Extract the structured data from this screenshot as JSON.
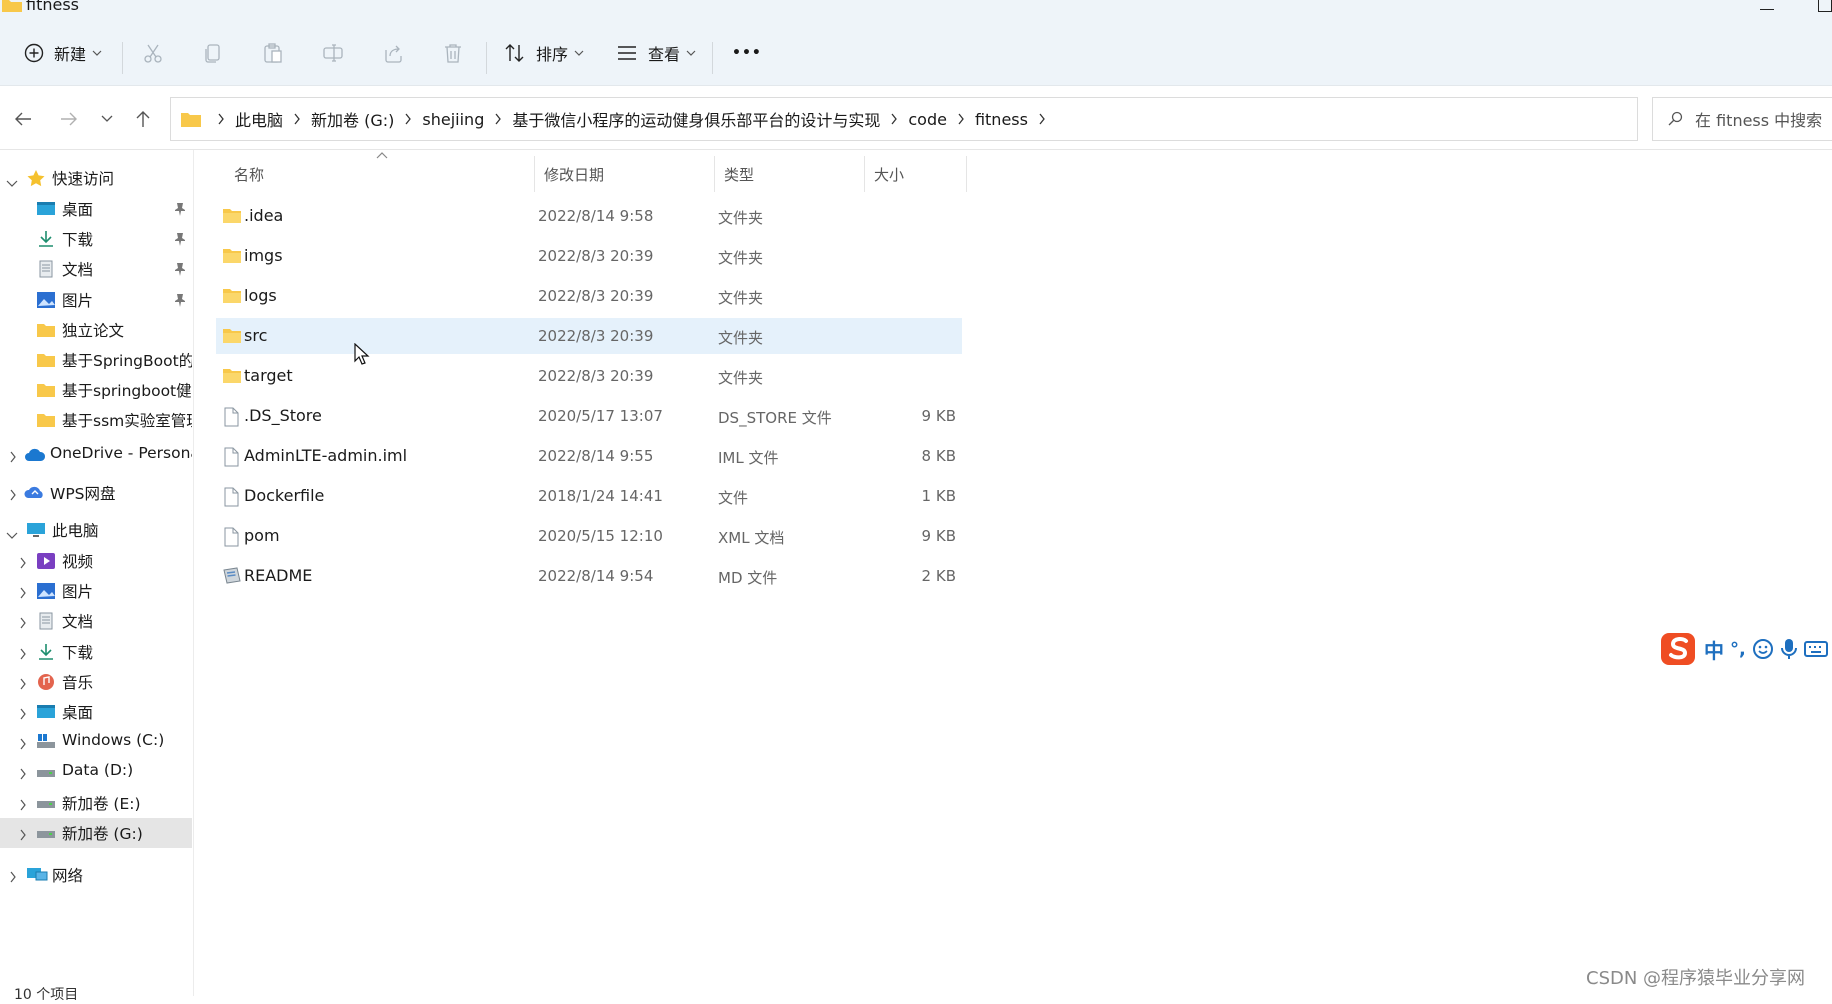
{
  "window": {
    "title": "fitness"
  },
  "toolbar": {
    "new_label": "新建",
    "sort_label": "排序",
    "view_label": "查看",
    "more_label": "•••",
    "icons": [
      "plus-circle-icon",
      "cut-icon",
      "copy-icon",
      "paste-icon",
      "rename-icon",
      "share-icon",
      "delete-icon",
      "sort-icon",
      "view-icon",
      "more-icon"
    ]
  },
  "address": {
    "crumbs": [
      "此电脑",
      "新加卷 (G:)",
      "shejiing",
      "基于微信小程序的运动健身俱乐部平台的设计与实现",
      "code",
      "fitness"
    ],
    "search_placeholder": "在 fitness 中搜索"
  },
  "sidebar": {
    "quick_access": "快速访问",
    "quick_items": [
      "桌面",
      "下载",
      "文档",
      "图片",
      "独立论文",
      "基于SpringBoot的",
      "基于springboot健",
      "基于ssm实验室管理"
    ],
    "onedrive": "OneDrive - Persona",
    "wps": "WPS网盘",
    "this_pc": "此电脑",
    "pc_items": [
      "视频",
      "图片",
      "文档",
      "下载",
      "音乐",
      "桌面",
      "Windows (C:)",
      "Data (D:)",
      "新加卷 (E:)",
      "新加卷 (G:)"
    ],
    "network": "网络"
  },
  "columns": {
    "name": "名称",
    "date": "修改日期",
    "type": "类型",
    "size": "大小"
  },
  "files": [
    {
      "name": ".idea",
      "date": "2022/8/14 9:58",
      "type": "文件夹",
      "size": "",
      "icon": "folder-icon"
    },
    {
      "name": "imgs",
      "date": "2022/8/3 20:39",
      "type": "文件夹",
      "size": "",
      "icon": "folder-icon"
    },
    {
      "name": "logs",
      "date": "2022/8/3 20:39",
      "type": "文件夹",
      "size": "",
      "icon": "folder-icon"
    },
    {
      "name": "src",
      "date": "2022/8/3 20:39",
      "type": "文件夹",
      "size": "",
      "icon": "folder-icon"
    },
    {
      "name": "target",
      "date": "2022/8/3 20:39",
      "type": "文件夹",
      "size": "",
      "icon": "folder-icon"
    },
    {
      "name": ".DS_Store",
      "date": "2020/5/17 13:07",
      "type": "DS_STORE 文件",
      "size": "9 KB",
      "icon": "file-icon"
    },
    {
      "name": "AdminLTE-admin.iml",
      "date": "2022/8/14 9:55",
      "type": "IML 文件",
      "size": "8 KB",
      "icon": "file-icon"
    },
    {
      "name": "Dockerfile",
      "date": "2018/1/24 14:41",
      "type": "文件",
      "size": "1 KB",
      "icon": "file-icon"
    },
    {
      "name": "pom",
      "date": "2020/5/15 12:10",
      "type": "XML 文档",
      "size": "9 KB",
      "icon": "file-icon"
    },
    {
      "name": "README",
      "date": "2022/8/14 9:54",
      "type": "MD 文件",
      "size": "2 KB",
      "icon": "md-file-icon"
    }
  ],
  "status": {
    "count": "10 个项目"
  },
  "ime": {
    "mode": "中",
    "punct": "°,"
  },
  "watermark": "CSDN @程序猿毕业分享网",
  "colors": {
    "accent": "#0067c0",
    "selection": "#e5f1fb",
    "folder": "#f8c84a",
    "toolbar_bg": "#eef4f9"
  }
}
